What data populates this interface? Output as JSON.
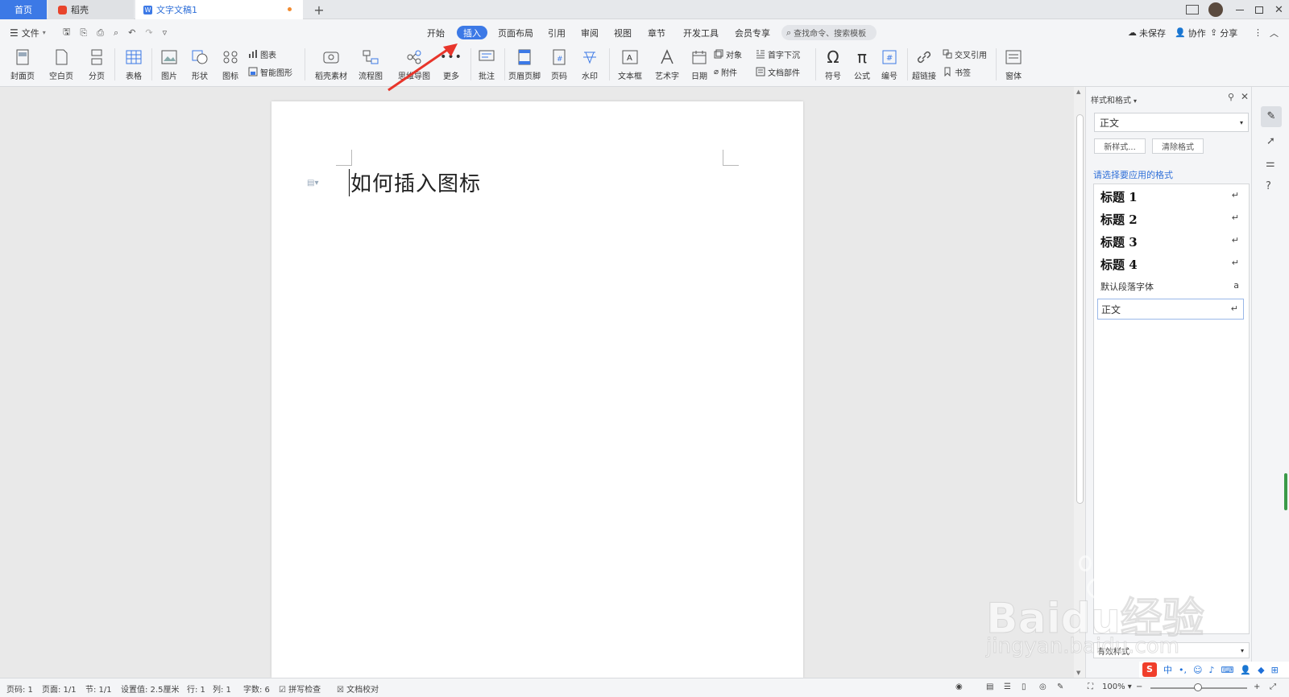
{
  "tabs": {
    "home": "首页",
    "daoke": "稻壳",
    "doc": "文字文稿1",
    "add": "+"
  },
  "menu": {
    "file": "文件",
    "items": [
      "开始",
      "插入",
      "页面布局",
      "引用",
      "审阅",
      "视图",
      "章节",
      "开发工具",
      "会员专享"
    ],
    "active": "插入",
    "search_placeholder": "查找命令、搜索模板",
    "unsaved": "未保存",
    "collab": "协作",
    "share": "分享"
  },
  "ribbon": {
    "cover": "封面页",
    "blank": "空白页",
    "pagebreak": "分页",
    "table": "表格",
    "picture": "图片",
    "shape": "形状",
    "icon": "图标",
    "chart": "图表",
    "smartart": "智能图形",
    "material": "稻壳素材",
    "flowchart": "流程图",
    "mindmap": "思维导图",
    "more": "更多",
    "comment": "批注",
    "header_footer": "页眉页脚",
    "page_number": "页码",
    "watermark": "水印",
    "textbox": "文本框",
    "wordart": "艺术字",
    "date": "日期",
    "object": "对象",
    "attachment": "附件",
    "dropcap": "首字下沉",
    "docpart": "文档部件",
    "symbol": "符号",
    "formula": "公式",
    "numbering": "编号",
    "hyperlink": "超链接",
    "crossref": "交叉引用",
    "bookmark": "书签",
    "window": "窗体"
  },
  "document": {
    "title_text": "如何插入图标"
  },
  "pane": {
    "title": "样式和格式",
    "current_style": "正文",
    "new_style": "新样式...",
    "clear_format": "清除格式",
    "prompt": "请选择要应用的格式",
    "styles": [
      {
        "label": "标题  1",
        "mark": "↵"
      },
      {
        "label": "标题  2",
        "mark": "↵"
      },
      {
        "label": "标题  3",
        "mark": "↵"
      },
      {
        "label": "标题  4",
        "mark": "↵"
      },
      {
        "label": "默认段落字体",
        "mark": "a"
      },
      {
        "label": "正文",
        "mark": "↵"
      }
    ],
    "show": "有效样式"
  },
  "status": {
    "page_code": "页码: 1",
    "page": "页面: 1/1",
    "section": "节: 1/1",
    "setting": "设置值: 2.5厘米",
    "row": "行: 1",
    "col": "列: 1",
    "words": "字数: 6",
    "spell": "拼写检查",
    "proof": "文档校对",
    "zoom": "100%"
  },
  "watermark": {
    "brand": "Baidu经验",
    "url": "jingyan.baidu.com"
  },
  "colors": {
    "accent": "#3c79e6",
    "link": "#3070d8",
    "arrow": "#e8352b"
  }
}
